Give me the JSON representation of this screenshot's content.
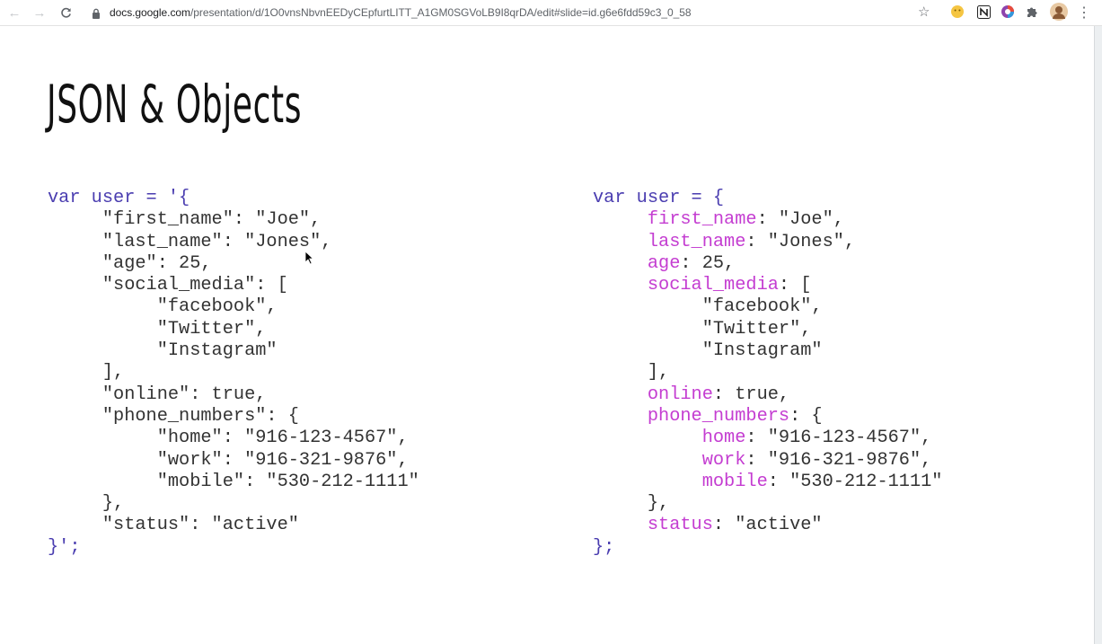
{
  "browser": {
    "url_host": "docs.google.com",
    "url_path": "/presentation/d/1O0vnsNbvnEEDyCEpfurtLITT_A1GM0SGVoLB9I8qrDA/edit#slide=id.g6e6fdd59c3_0_58"
  },
  "slide": {
    "title": "JSON & Objects",
    "left_code": [
      "var user = '{",
      "     \"first_name\": \"Joe\",",
      "     \"last_name\": \"Jones\",",
      "     \"age\": 25,",
      "     \"social_media\": [",
      "          \"facebook\",",
      "          \"Twitter\",",
      "          \"Instagram\"",
      "     ],",
      "     \"online\": true,",
      "     \"phone_numbers\": {",
      "          \"home\": \"916-123-4567\",",
      "          \"work\": \"916-321-9876\",",
      "          \"mobile\": \"530-212-1111\"",
      "     },",
      "     \"status\": \"active\"",
      "}';"
    ],
    "right_code": [
      "var user = {",
      "     first_name: \"Joe\",",
      "     last_name: \"Jones\",",
      "     age: 25,",
      "     social_media: [",
      "          \"facebook\",",
      "          \"Twitter\",",
      "          \"Instagram\"",
      "     ],",
      "     online: true,",
      "     phone_numbers: {",
      "          home: \"916-123-4567\",",
      "          work: \"916-321-9876\",",
      "          mobile: \"530-212-1111\"",
      "     },",
      "     status: \"active\"",
      "};"
    ]
  },
  "colors": {
    "keyword": "#4a3db0",
    "object_key": "#c43dd1",
    "code_text": "#333333"
  },
  "icons": [
    "back-icon",
    "forward-icon",
    "reload-icon",
    "lock-icon",
    "bookmark-star-icon",
    "extension-smiley-icon",
    "notion-icon",
    "color-wheel-icon",
    "puzzle-icon",
    "profile-avatar",
    "kebab-menu-icon",
    "mouse-pointer-icon"
  ]
}
